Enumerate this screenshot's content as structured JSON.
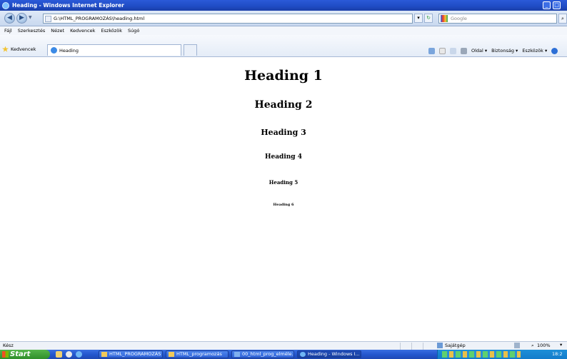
{
  "window": {
    "title": "Heading - Windows Internet Explorer",
    "controls": [
      "_",
      "□"
    ]
  },
  "address_bar": {
    "url": "G:\\HTML_PROGRAMOZÁS\\heading.html",
    "search_placeholder": "Google"
  },
  "menu": [
    "Fájl",
    "Szerkesztés",
    "Nézet",
    "Kedvencek",
    "Eszközök",
    "Súgó"
  ],
  "favorites": {
    "label": "Kedvencek",
    "tab_title": "Heading"
  },
  "command_bar": [
    "Oldal ▾",
    "Biztonság ▾",
    "Eszközök ▾"
  ],
  "content": {
    "headings": [
      "Heading 1",
      "Heading 2",
      "Heading 3",
      "Heading 4",
      "Heading 5",
      "Heading 6"
    ]
  },
  "status_bar": {
    "status": "Kész",
    "zone": "Sajátgép",
    "zoom": "100%"
  },
  "taskbar": {
    "start": "Start",
    "items": [
      "HTML_PROGRAMOZÁS",
      "HTML_programozás",
      "00_html_prog_elméle...",
      "Heading - Windows I..."
    ],
    "clock": "18:2"
  },
  "colors": {
    "titlebar": "#2b5ad8",
    "taskbar": "#2457cf",
    "start_button": "#3e9f37"
  }
}
